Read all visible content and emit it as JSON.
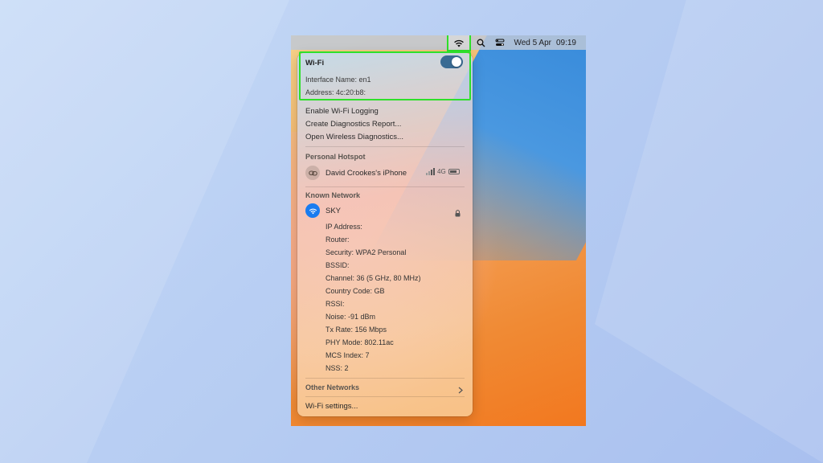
{
  "menubar": {
    "date": "Wed 5 Apr",
    "time": "09:19"
  },
  "wifi": {
    "title": "Wi-Fi",
    "toggle_on": true,
    "interface_name": "Interface Name: en1",
    "address": "Address: 4c:20:b8:"
  },
  "actions": [
    "Enable Wi-Fi Logging",
    "Create Diagnostics Report...",
    "Open Wireless Diagnostics..."
  ],
  "hotspot": {
    "section_label": "Personal Hotspot",
    "device_name": "David Crookes's iPhone",
    "network_type": "4G"
  },
  "known": {
    "section_label": "Known Network",
    "network_name": "SKY",
    "details": [
      "IP Address:",
      "Router:",
      "Security: WPA2 Personal",
      "BSSID:",
      "Channel: 36 (5 GHz, 80 MHz)",
      "Country Code: GB",
      "RSSI:",
      "Noise: -91 dBm",
      "Tx Rate: 156 Mbps",
      "PHY Mode: 802.11ac",
      "MCS Index: 7",
      "NSS: 2"
    ]
  },
  "other_networks": "Other Networks",
  "settings": "Wi-Fi settings...",
  "colors": {
    "highlight": "#2fe02a",
    "toggle": "#3a6b93",
    "sky_icon": "#1a7cf0"
  }
}
